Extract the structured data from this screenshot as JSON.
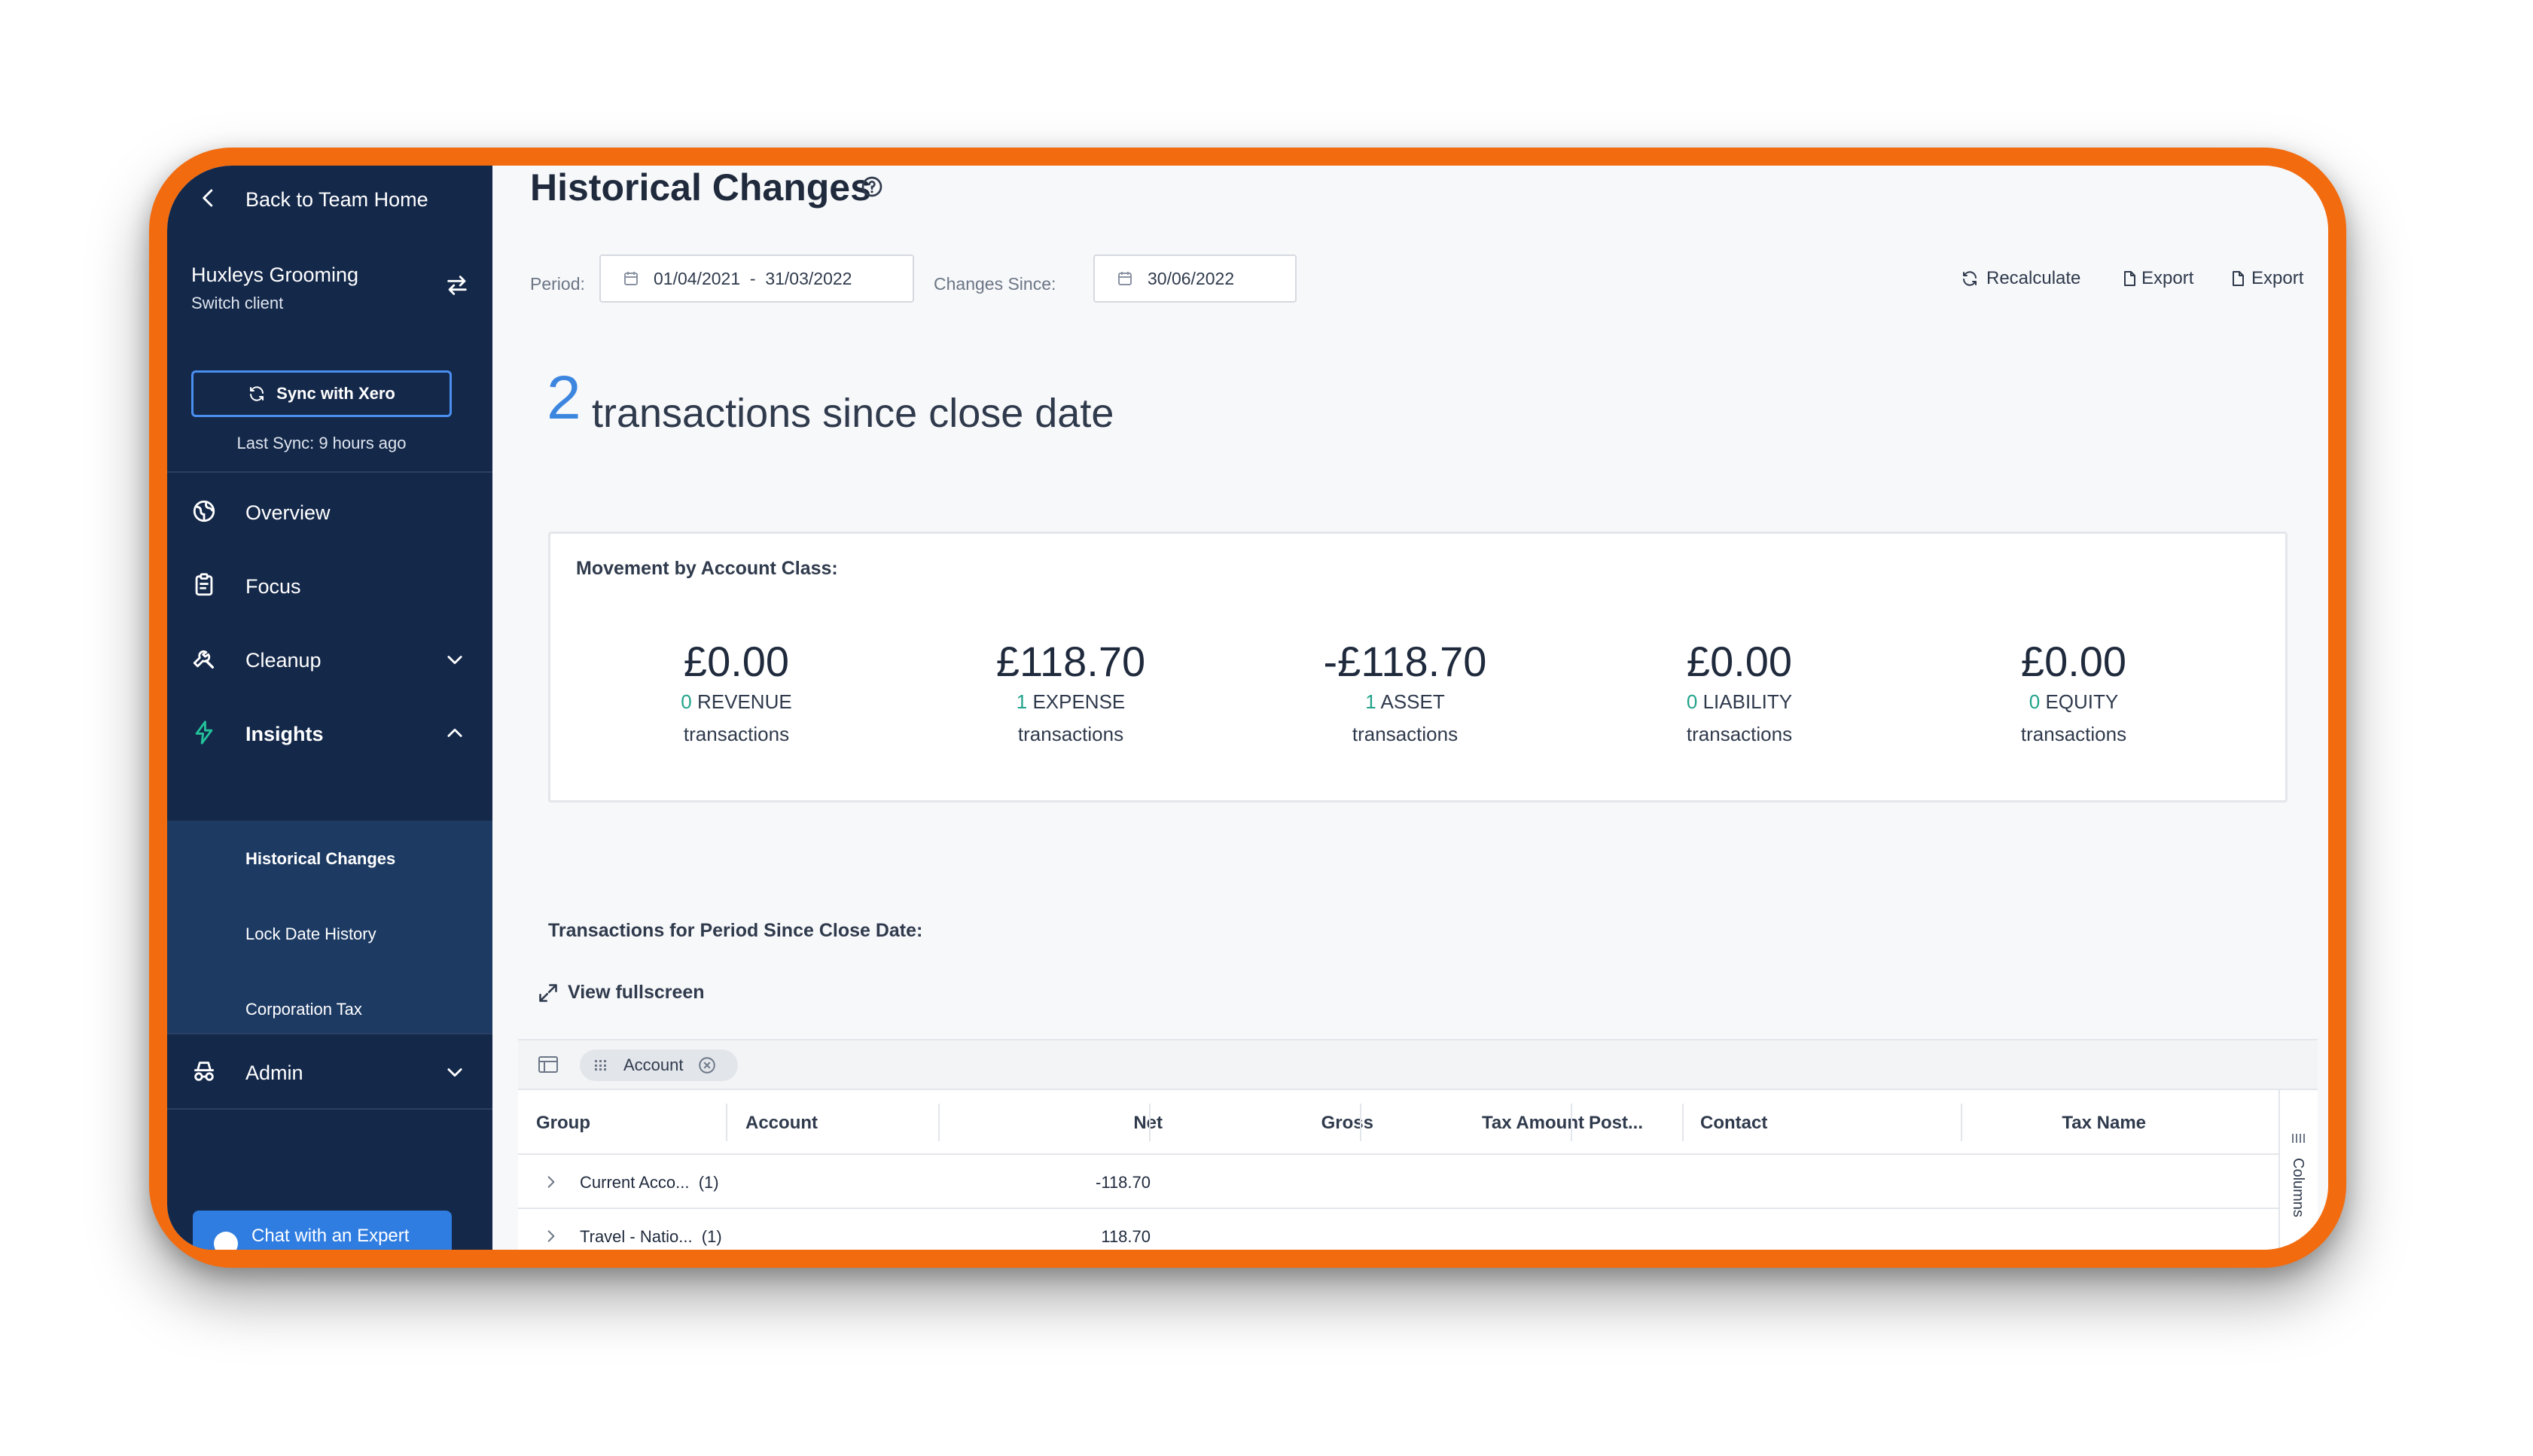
{
  "sidebar": {
    "back_label": "Back to Team Home",
    "client_name": "Huxleys Grooming",
    "switch_client": "Switch client",
    "sync_button": "Sync with Xero",
    "last_sync": "Last Sync: 9 hours ago",
    "nav": {
      "overview": "Overview",
      "focus": "Focus",
      "cleanup": "Cleanup",
      "insights": "Insights",
      "admin": "Admin"
    },
    "insights_sub": [
      "Historical Changes",
      "Lock Date History",
      "Corporation Tax"
    ],
    "chat_button": "Chat with an Expert"
  },
  "header": {
    "title": "Historical Changes",
    "period_label": "Period:",
    "period_value": "01/04/2021  -  31/03/2022",
    "changes_since_label": "Changes Since:",
    "changes_since_value": "30/06/2022",
    "actions": {
      "recalculate": "Recalculate",
      "export1": "Export",
      "export2": "Export"
    }
  },
  "summary": {
    "count": "2",
    "text": "transactions since close date"
  },
  "movement": {
    "title": "Movement by Account Class:",
    "stats": [
      {
        "amount": "£0.00",
        "count": "0",
        "class": "REVENUE",
        "suffix": "transactions"
      },
      {
        "amount": "£118.70",
        "count": "1",
        "class": "EXPENSE",
        "suffix": "transactions"
      },
      {
        "amount": "-£118.70",
        "count": "1",
        "class": "ASSET",
        "suffix": "transactions"
      },
      {
        "amount": "£0.00",
        "count": "0",
        "class": "LIABILITY",
        "suffix": "transactions"
      },
      {
        "amount": "£0.00",
        "count": "0",
        "class": "EQUITY",
        "suffix": "transactions"
      }
    ]
  },
  "transactions": {
    "title": "Transactions for Period Since Close Date:",
    "fullscreen": "View fullscreen",
    "group_chip": "Account",
    "columns": [
      "Group",
      "Account",
      "Net",
      "Gross",
      "Tax Amount",
      "Post...",
      "Contact",
      "Tax Name"
    ],
    "rows": [
      {
        "group": "Current Acco...  (1)",
        "net": "-118.70"
      },
      {
        "group": "Travel - Natio...  (1)",
        "net": "118.70"
      }
    ],
    "columns_panel": "Columns"
  },
  "colors": {
    "accent": "#3d86e0",
    "sidebar": "#14284a",
    "frame": "#f26b0f",
    "positive": "#22a38a"
  }
}
